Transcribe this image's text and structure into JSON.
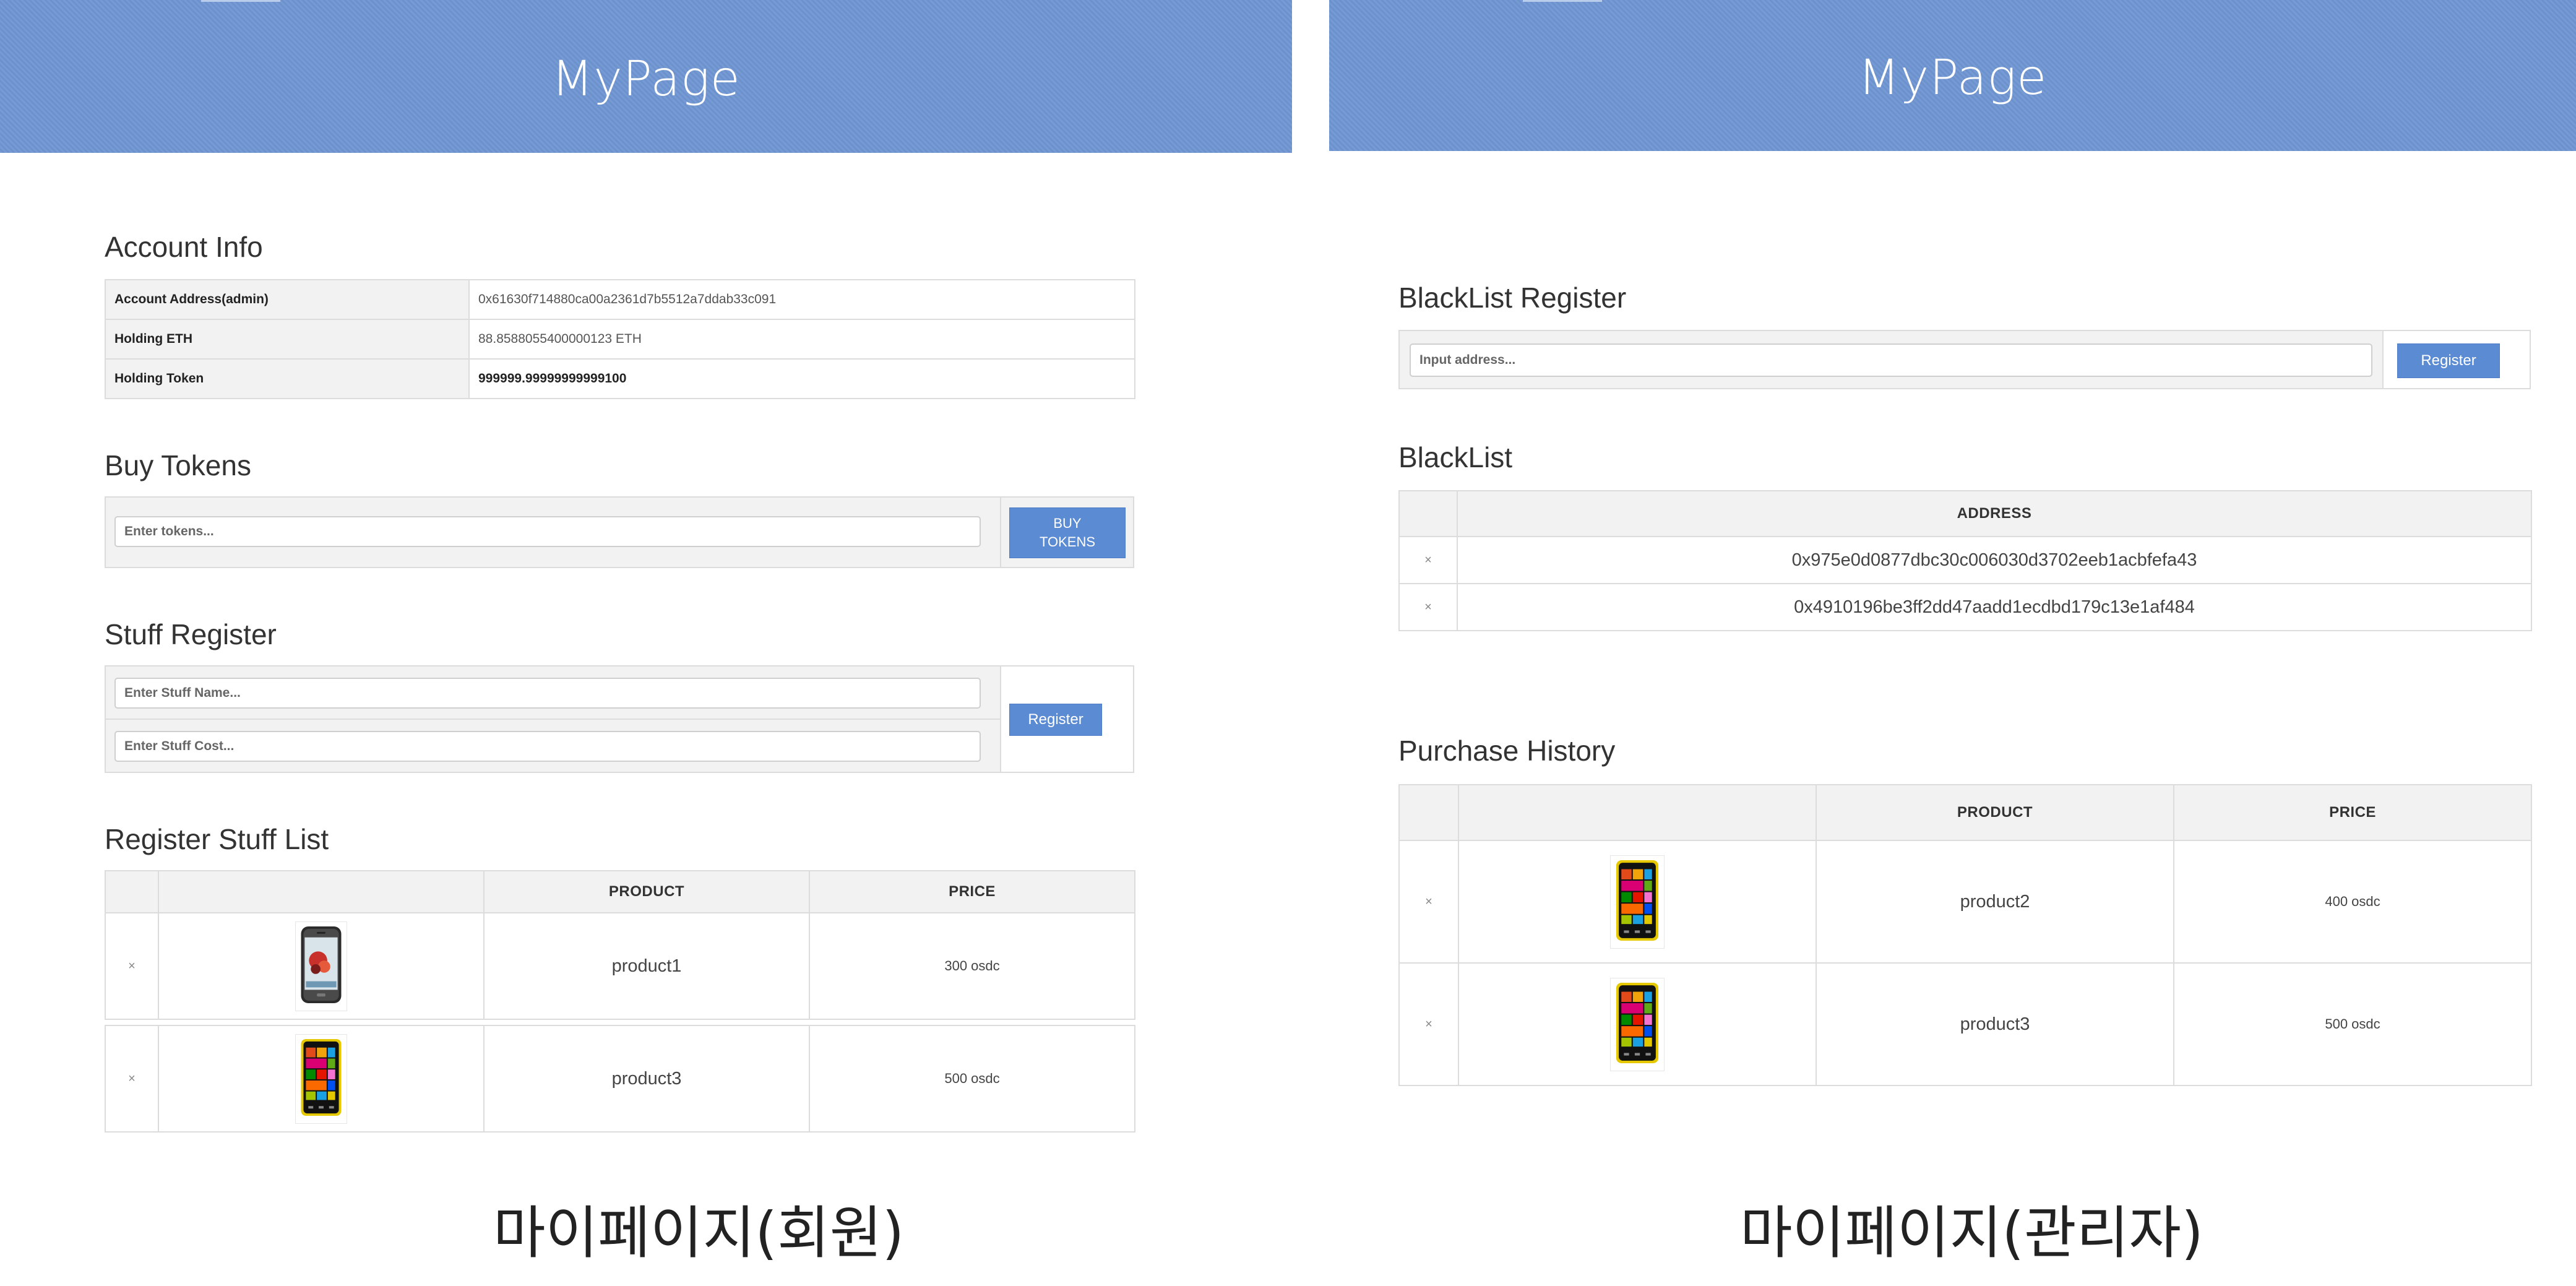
{
  "left": {
    "banner_title": "MyPage",
    "account_info": {
      "title": "Account Info",
      "rows": [
        {
          "key": "Account Address(admin)",
          "value": "0x61630f714880ca00a2361d7b5512a7ddab33c091"
        },
        {
          "key": "Holding ETH",
          "value": "88.8588055400000123 ETH"
        },
        {
          "key": "Holding Token",
          "value": "999999.99999999999100"
        }
      ]
    },
    "buy_tokens": {
      "title": "Buy Tokens",
      "placeholder": "Enter tokens...",
      "button_line1": "BUY",
      "button_line2": "TOKENS"
    },
    "stuff_register": {
      "title": "Stuff Register",
      "name_placeholder": "Enter Stuff Name...",
      "cost_placeholder": "Enter Stuff Cost...",
      "button": "Register"
    },
    "stuff_list": {
      "title": "Register Stuff List",
      "headers": [
        "",
        "",
        "PRODUCT",
        "PRICE"
      ],
      "rows": [
        {
          "remove": "×",
          "product": "product1",
          "price": "300 osdc"
        },
        {
          "remove": "×",
          "product": "product3",
          "price": "500 osdc"
        }
      ]
    },
    "caption": "마이페이지(회원)"
  },
  "right": {
    "banner_title": "MyPage",
    "blacklist_register": {
      "title": "BlackList Register",
      "placeholder": "Input address...",
      "button": "Register"
    },
    "blacklist": {
      "title": "BlackList",
      "header": "ADDRESS",
      "rows": [
        {
          "remove": "×",
          "address": "0x975e0d0877dbc30c006030d3702eeb1acbfefa43"
        },
        {
          "remove": "×",
          "address": "0x4910196be3ff2dd47aadd1ecdbd179c13e1af484"
        }
      ]
    },
    "purchase_history": {
      "title": "Purchase History",
      "headers": [
        "",
        "",
        "PRODUCT",
        "PRICE"
      ],
      "rows": [
        {
          "remove": "×",
          "product": "product2",
          "price": "400 osdc"
        },
        {
          "remove": "×",
          "product": "product3",
          "price": "500 osdc"
        }
      ]
    },
    "caption": "마이페이지(관리자)"
  },
  "colors": {
    "banner": "#7096d3",
    "button": "#5b8bd2",
    "header_bg": "#f2f2f2",
    "border": "#dcdcdc"
  },
  "icons": {
    "phone_android": "android-phone-icon",
    "phone_windows": "windows-phone-icon"
  }
}
